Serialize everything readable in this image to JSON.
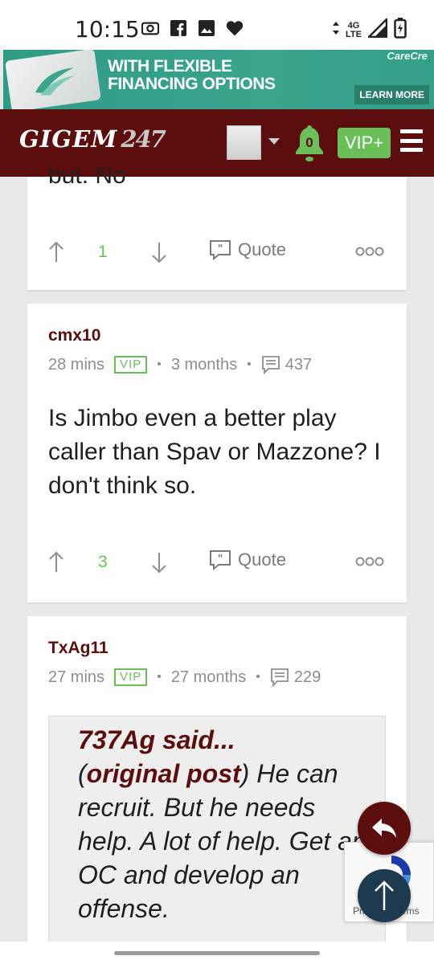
{
  "status_bar": {
    "time": "10:15",
    "left_icons": [
      "radio-icon",
      "facebook-icon",
      "image-icon",
      "heart-icon"
    ],
    "network_label_top": "4G",
    "network_label_bottom": "LTE",
    "right_icons": [
      "data-arrows-icon",
      "signal-icon",
      "battery-charging-icon"
    ]
  },
  "ad": {
    "headline_line1": "WITH FLEXIBLE",
    "headline_line2": "FINANCING OPTIONS",
    "brand": "CareCre",
    "cta": "LEARN MORE",
    "accent": "#35a08a"
  },
  "nav": {
    "logo_word": "GIGEM",
    "logo_number": "247",
    "notification_count": "0",
    "vip_label": "VIP+",
    "brand_color": "#5c0d0d",
    "vip_color": "#6bbf59"
  },
  "posts": [
    {
      "partial_text": "but. No",
      "score": "1",
      "quote_label": "Quote"
    },
    {
      "author": "cmx10",
      "time_ago": "28 mins",
      "badge": "VIP",
      "tenure": "3 months",
      "post_count": "437",
      "body": "Is Jimbo even a better play caller than Spav or Mazzone? I don't think so.",
      "score": "3",
      "quote_label": "Quote"
    },
    {
      "author": "TxAg11",
      "time_ago": "27 mins",
      "badge": "VIP",
      "tenure": "27 months",
      "post_count": "229",
      "quoted_author": "737Ag said...",
      "quoted_source": "original post",
      "quoted_text": "He can recruit. But he needs help. A lot of help. Get an OC and develop an offense."
    }
  ],
  "recaptcha": {
    "text": "Privacy - Terms"
  }
}
